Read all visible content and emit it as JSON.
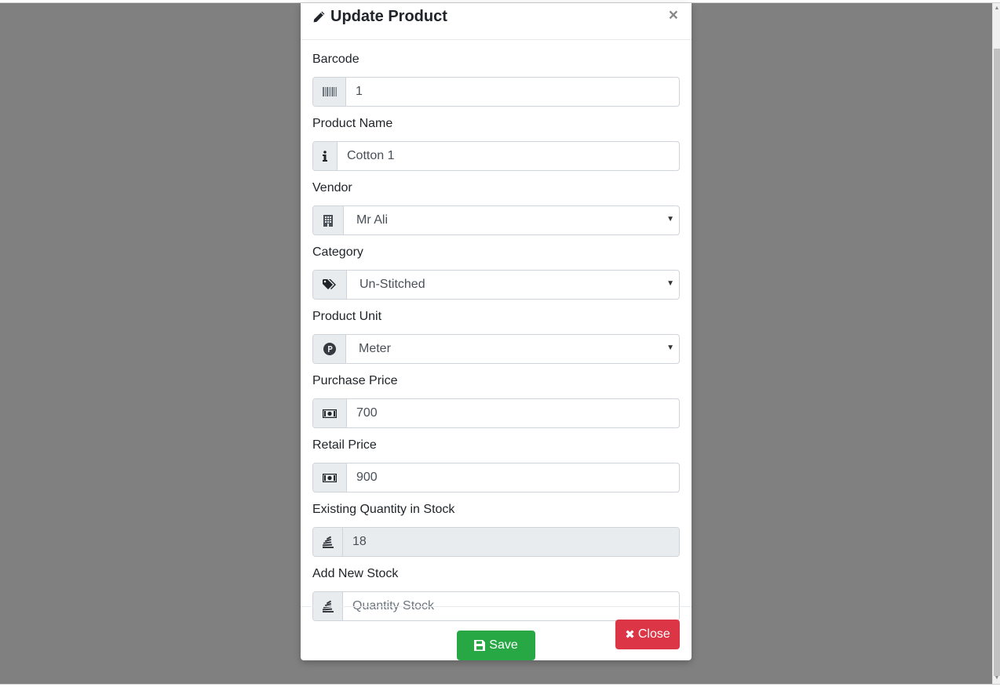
{
  "modal": {
    "title": "Update Product",
    "close_glyph": "×"
  },
  "fields": {
    "barcode": {
      "label": "Barcode",
      "value": "1",
      "icon": "barcode-icon"
    },
    "product_name": {
      "label": "Product Name",
      "value": "Cotton 1",
      "icon": "info-icon"
    },
    "vendor": {
      "label": "Vendor",
      "value": "Mr Ali",
      "icon": "building-icon"
    },
    "category": {
      "label": "Category",
      "value": "Un-Stitched",
      "icon": "tags-icon"
    },
    "product_unit": {
      "label": "Product Unit",
      "value": "Meter",
      "icon": "product-hunt-icon"
    },
    "purchase_price": {
      "label": "Purchase Price",
      "value": "700",
      "icon": "money-icon"
    },
    "retail_price": {
      "label": "Retail Price",
      "value": "900",
      "icon": "money-icon"
    },
    "existing_qty": {
      "label": "Existing Quantity in Stock",
      "value": "18",
      "icon": "stack-icon"
    },
    "new_stock": {
      "label": "Add New Stock",
      "value": "",
      "placeholder": "Quantity Stock",
      "icon": "stack-icon"
    }
  },
  "buttons": {
    "save_label": "Save",
    "close_label": "Close"
  },
  "colors": {
    "save": "#28a745",
    "close": "#dc3545",
    "backdrop": "#808080"
  }
}
